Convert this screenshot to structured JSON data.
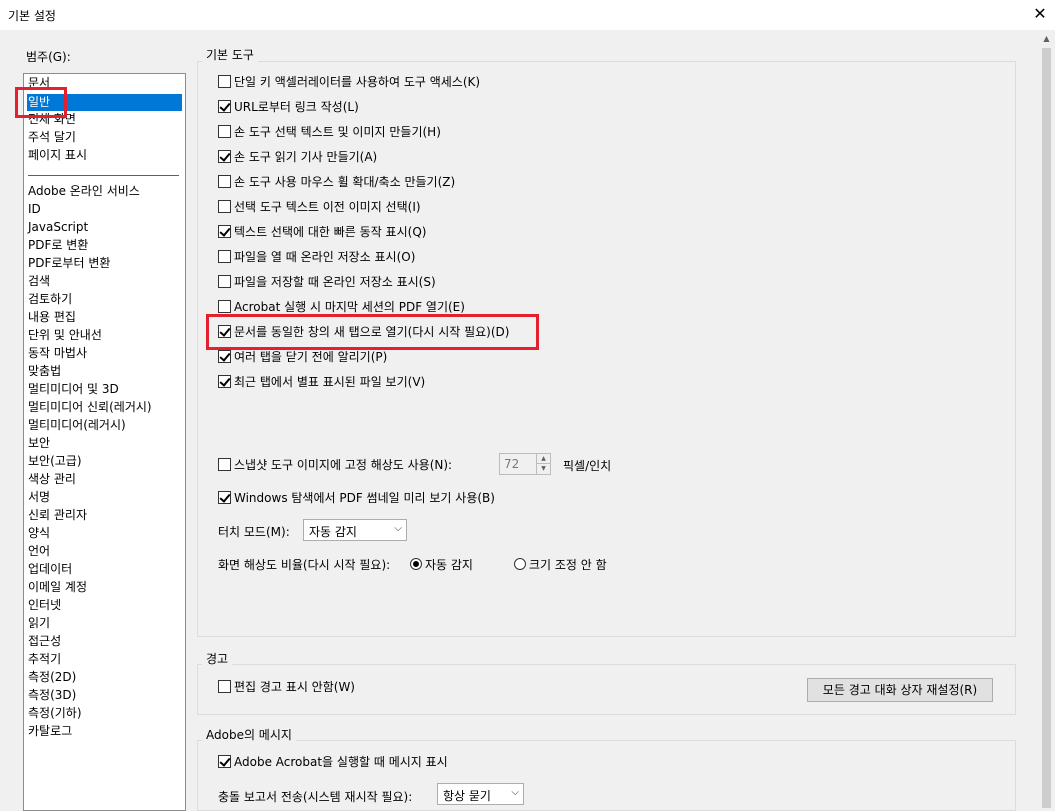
{
  "window": {
    "title": "기본 설정",
    "close_glyph": "✕"
  },
  "categories": {
    "label": "범주(G):",
    "items_top": [
      "문서",
      "일반",
      "전체 화면",
      "주석 달기",
      "페이지 표시"
    ],
    "items_bottom": [
      "Adobe 온라인 서비스",
      "ID",
      "JavaScript",
      "PDF로 변환",
      "PDF로부터 변환",
      "검색",
      "검토하기",
      "내용 편집",
      "단위 및 안내선",
      "동작 마법사",
      "맞춤법",
      "멀티미디어 및 3D",
      "멀티미디어 신뢰(레거시)",
      "멀티미디어(레거시)",
      "보안",
      "보안(고급)",
      "색상 관리",
      "서명",
      "신뢰 관리자",
      "양식",
      "언어",
      "업데이터",
      "이메일 계정",
      "인터넷",
      "읽기",
      "접근성",
      "추적기",
      "측정(2D)",
      "측정(3D)",
      "측정(기하)",
      "카탈로그"
    ],
    "selected": "일반"
  },
  "basic_tools": {
    "title": "기본 도구",
    "options": [
      {
        "label": "단일 키 액셀러레이터를 사용하여 도구 액세스(K)",
        "checked": false
      },
      {
        "label": "URL로부터 링크 작성(L)",
        "checked": true
      },
      {
        "label": "손 도구 선택 텍스트 및 이미지 만들기(H)",
        "checked": false
      },
      {
        "label": "손 도구 읽기 기사 만들기(A)",
        "checked": true
      },
      {
        "label": "손 도구 사용 마우스 휠 확대/축소 만들기(Z)",
        "checked": false
      },
      {
        "label": "선택 도구 텍스트 이전 이미지 선택(I)",
        "checked": false
      },
      {
        "label": "텍스트 선택에 대한 빠른 동작 표시(Q)",
        "checked": true
      },
      {
        "label": "파일을 열 때 온라인 저장소 표시(O)",
        "checked": false
      },
      {
        "label": "파일을 저장할 때 온라인 저장소 표시(S)",
        "checked": false
      },
      {
        "label": "Acrobat 실행 시 마지막 세션의 PDF 열기(E)",
        "checked": false
      },
      {
        "label": "문서를 동일한 창의 새 탭으로 열기(다시 시작 필요)(D)",
        "checked": true
      },
      {
        "label": "여러 탭을 닫기 전에 알리기(P)",
        "checked": true
      },
      {
        "label": "최근 탭에서 별표 표시된 파일 보기(V)",
        "checked": true
      }
    ],
    "snapshot": {
      "label": "스냅샷 도구 이미지에 고정 해상도 사용(N):",
      "checked": false,
      "value": "72",
      "unit": "픽셀/인치"
    },
    "thumbnail": {
      "label": "Windows 탐색에서 PDF 썸네일 미리 보기 사용(B)",
      "checked": true
    },
    "touch_mode": {
      "label": "터치 모드(M):",
      "value": "자동 감지"
    },
    "scaling": {
      "label": "화면 해상도 비율(다시 시작 필요):",
      "option_auto": "자동 감지",
      "option_none": "크기 조정 안 함",
      "selected": "자동 감지"
    }
  },
  "warnings": {
    "title": "경고",
    "option": {
      "label": "편집 경고 표시 안함(W)",
      "checked": false
    },
    "reset_button": "모든 경고 대화 상자 재설정(R)"
  },
  "adobe_messages": {
    "title": "Adobe의 메시지",
    "option": {
      "label": "Adobe Acrobat을 실행할 때 메시지 표시",
      "checked": true
    },
    "crash_report": {
      "label": "충돌 보고서 전송(시스템 재시작 필요):",
      "value": "항상 묻기"
    }
  },
  "glyphs": {
    "dropdown": "⌵",
    "spin_up": "▲",
    "spin_down": "▼",
    "scroll_up": "▲"
  }
}
